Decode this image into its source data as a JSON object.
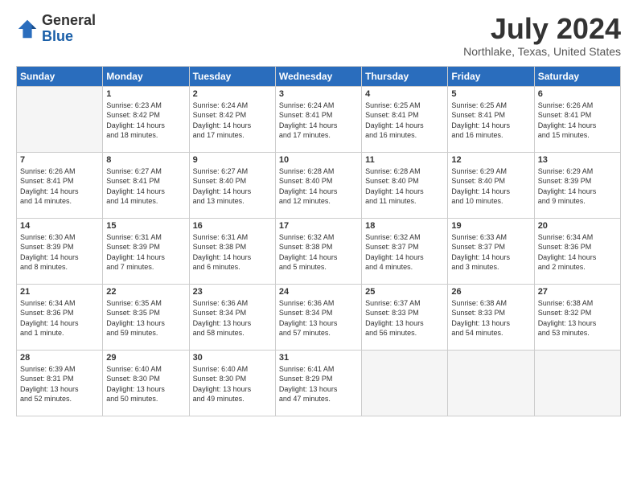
{
  "header": {
    "logo_general": "General",
    "logo_blue": "Blue",
    "month": "July 2024",
    "location": "Northlake, Texas, United States"
  },
  "calendar": {
    "days_of_week": [
      "Sunday",
      "Monday",
      "Tuesday",
      "Wednesday",
      "Thursday",
      "Friday",
      "Saturday"
    ],
    "weeks": [
      [
        {
          "day": "",
          "info": ""
        },
        {
          "day": "1",
          "info": "Sunrise: 6:23 AM\nSunset: 8:42 PM\nDaylight: 14 hours\nand 18 minutes."
        },
        {
          "day": "2",
          "info": "Sunrise: 6:24 AM\nSunset: 8:42 PM\nDaylight: 14 hours\nand 17 minutes."
        },
        {
          "day": "3",
          "info": "Sunrise: 6:24 AM\nSunset: 8:41 PM\nDaylight: 14 hours\nand 17 minutes."
        },
        {
          "day": "4",
          "info": "Sunrise: 6:25 AM\nSunset: 8:41 PM\nDaylight: 14 hours\nand 16 minutes."
        },
        {
          "day": "5",
          "info": "Sunrise: 6:25 AM\nSunset: 8:41 PM\nDaylight: 14 hours\nand 16 minutes."
        },
        {
          "day": "6",
          "info": "Sunrise: 6:26 AM\nSunset: 8:41 PM\nDaylight: 14 hours\nand 15 minutes."
        }
      ],
      [
        {
          "day": "7",
          "info": "Sunrise: 6:26 AM\nSunset: 8:41 PM\nDaylight: 14 hours\nand 14 minutes."
        },
        {
          "day": "8",
          "info": "Sunrise: 6:27 AM\nSunset: 8:41 PM\nDaylight: 14 hours\nand 14 minutes."
        },
        {
          "day": "9",
          "info": "Sunrise: 6:27 AM\nSunset: 8:40 PM\nDaylight: 14 hours\nand 13 minutes."
        },
        {
          "day": "10",
          "info": "Sunrise: 6:28 AM\nSunset: 8:40 PM\nDaylight: 14 hours\nand 12 minutes."
        },
        {
          "day": "11",
          "info": "Sunrise: 6:28 AM\nSunset: 8:40 PM\nDaylight: 14 hours\nand 11 minutes."
        },
        {
          "day": "12",
          "info": "Sunrise: 6:29 AM\nSunset: 8:40 PM\nDaylight: 14 hours\nand 10 minutes."
        },
        {
          "day": "13",
          "info": "Sunrise: 6:29 AM\nSunset: 8:39 PM\nDaylight: 14 hours\nand 9 minutes."
        }
      ],
      [
        {
          "day": "14",
          "info": "Sunrise: 6:30 AM\nSunset: 8:39 PM\nDaylight: 14 hours\nand 8 minutes."
        },
        {
          "day": "15",
          "info": "Sunrise: 6:31 AM\nSunset: 8:39 PM\nDaylight: 14 hours\nand 7 minutes."
        },
        {
          "day": "16",
          "info": "Sunrise: 6:31 AM\nSunset: 8:38 PM\nDaylight: 14 hours\nand 6 minutes."
        },
        {
          "day": "17",
          "info": "Sunrise: 6:32 AM\nSunset: 8:38 PM\nDaylight: 14 hours\nand 5 minutes."
        },
        {
          "day": "18",
          "info": "Sunrise: 6:32 AM\nSunset: 8:37 PM\nDaylight: 14 hours\nand 4 minutes."
        },
        {
          "day": "19",
          "info": "Sunrise: 6:33 AM\nSunset: 8:37 PM\nDaylight: 14 hours\nand 3 minutes."
        },
        {
          "day": "20",
          "info": "Sunrise: 6:34 AM\nSunset: 8:36 PM\nDaylight: 14 hours\nand 2 minutes."
        }
      ],
      [
        {
          "day": "21",
          "info": "Sunrise: 6:34 AM\nSunset: 8:36 PM\nDaylight: 14 hours\nand 1 minute."
        },
        {
          "day": "22",
          "info": "Sunrise: 6:35 AM\nSunset: 8:35 PM\nDaylight: 13 hours\nand 59 minutes."
        },
        {
          "day": "23",
          "info": "Sunrise: 6:36 AM\nSunset: 8:34 PM\nDaylight: 13 hours\nand 58 minutes."
        },
        {
          "day": "24",
          "info": "Sunrise: 6:36 AM\nSunset: 8:34 PM\nDaylight: 13 hours\nand 57 minutes."
        },
        {
          "day": "25",
          "info": "Sunrise: 6:37 AM\nSunset: 8:33 PM\nDaylight: 13 hours\nand 56 minutes."
        },
        {
          "day": "26",
          "info": "Sunrise: 6:38 AM\nSunset: 8:33 PM\nDaylight: 13 hours\nand 54 minutes."
        },
        {
          "day": "27",
          "info": "Sunrise: 6:38 AM\nSunset: 8:32 PM\nDaylight: 13 hours\nand 53 minutes."
        }
      ],
      [
        {
          "day": "28",
          "info": "Sunrise: 6:39 AM\nSunset: 8:31 PM\nDaylight: 13 hours\nand 52 minutes."
        },
        {
          "day": "29",
          "info": "Sunrise: 6:40 AM\nSunset: 8:30 PM\nDaylight: 13 hours\nand 50 minutes."
        },
        {
          "day": "30",
          "info": "Sunrise: 6:40 AM\nSunset: 8:30 PM\nDaylight: 13 hours\nand 49 minutes."
        },
        {
          "day": "31",
          "info": "Sunrise: 6:41 AM\nSunset: 8:29 PM\nDaylight: 13 hours\nand 47 minutes."
        },
        {
          "day": "",
          "info": ""
        },
        {
          "day": "",
          "info": ""
        },
        {
          "day": "",
          "info": ""
        }
      ]
    ]
  }
}
